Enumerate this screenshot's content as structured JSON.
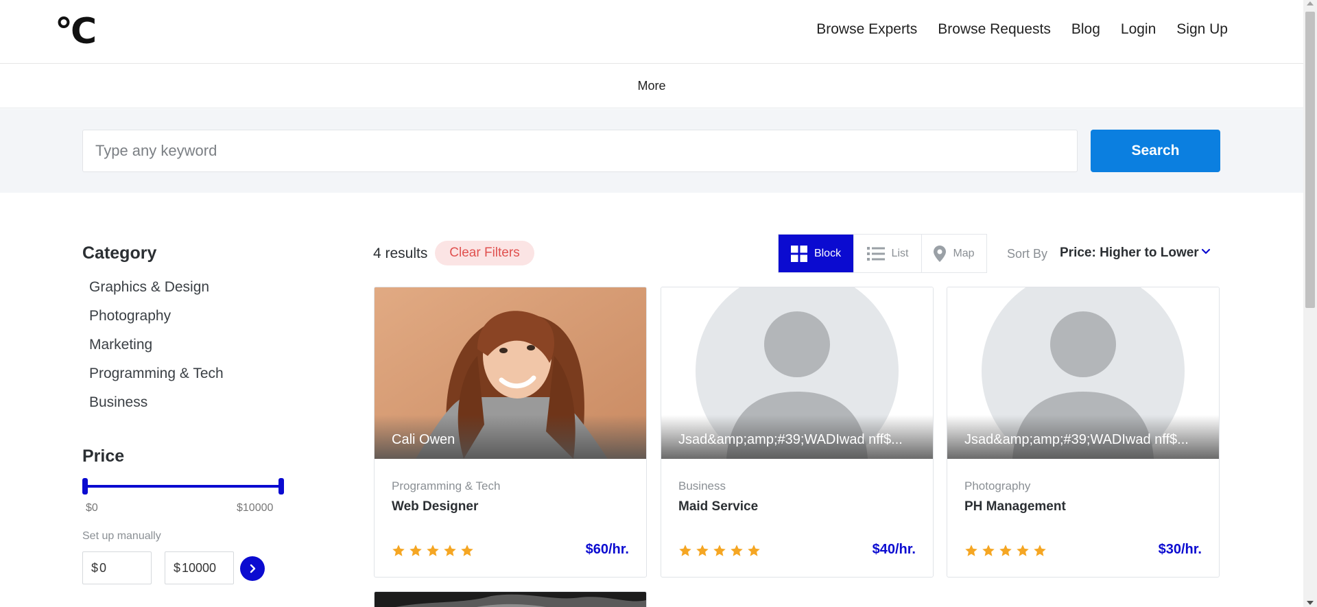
{
  "header": {
    "logo": "°C",
    "nav": [
      "Browse Experts",
      "Browse Requests",
      "Blog",
      "Login",
      "Sign Up"
    ],
    "subnav": "More"
  },
  "search": {
    "placeholder": "Type any keyword",
    "button": "Search"
  },
  "sidebar": {
    "category_title": "Category",
    "categories": [
      "Graphics & Design",
      "Photography",
      "Marketing",
      "Programming & Tech",
      "Business"
    ],
    "price_title": "Price",
    "slider_min": "$0",
    "slider_max": "$10000",
    "manual_label": "Set up manually",
    "currency": "$",
    "min_value": "0",
    "max_value": "10000"
  },
  "results": {
    "count": "4 results",
    "clear": "Clear Filters",
    "views": [
      "Block",
      "List",
      "Map"
    ],
    "active_view": "Block",
    "sort_label": "Sort By",
    "sort_value": "Price: Higher to Lower"
  },
  "cards": [
    {
      "name": "Cali Owen",
      "category": "Programming & Tech",
      "title": "Web Designer",
      "price": "$60/hr.",
      "rating": 5,
      "image": "photo"
    },
    {
      "name": "Jsad&amp;amp;#39;WADIwad nff$...",
      "category": "Business",
      "title": "Maid Service",
      "price": "$40/hr.",
      "rating": 5,
      "image": "avatar"
    },
    {
      "name": "Jsad&amp;amp;#39;WADIwad nff$...",
      "category": "Photography",
      "title": "PH Management",
      "price": "$30/hr.",
      "rating": 5,
      "image": "avatar"
    }
  ],
  "colors": {
    "primary": "#0b0bd0",
    "search_button": "#0b7fe0",
    "star": "#f5a623",
    "clear_bg": "#fbe4e4",
    "clear_text": "#e0514f"
  }
}
